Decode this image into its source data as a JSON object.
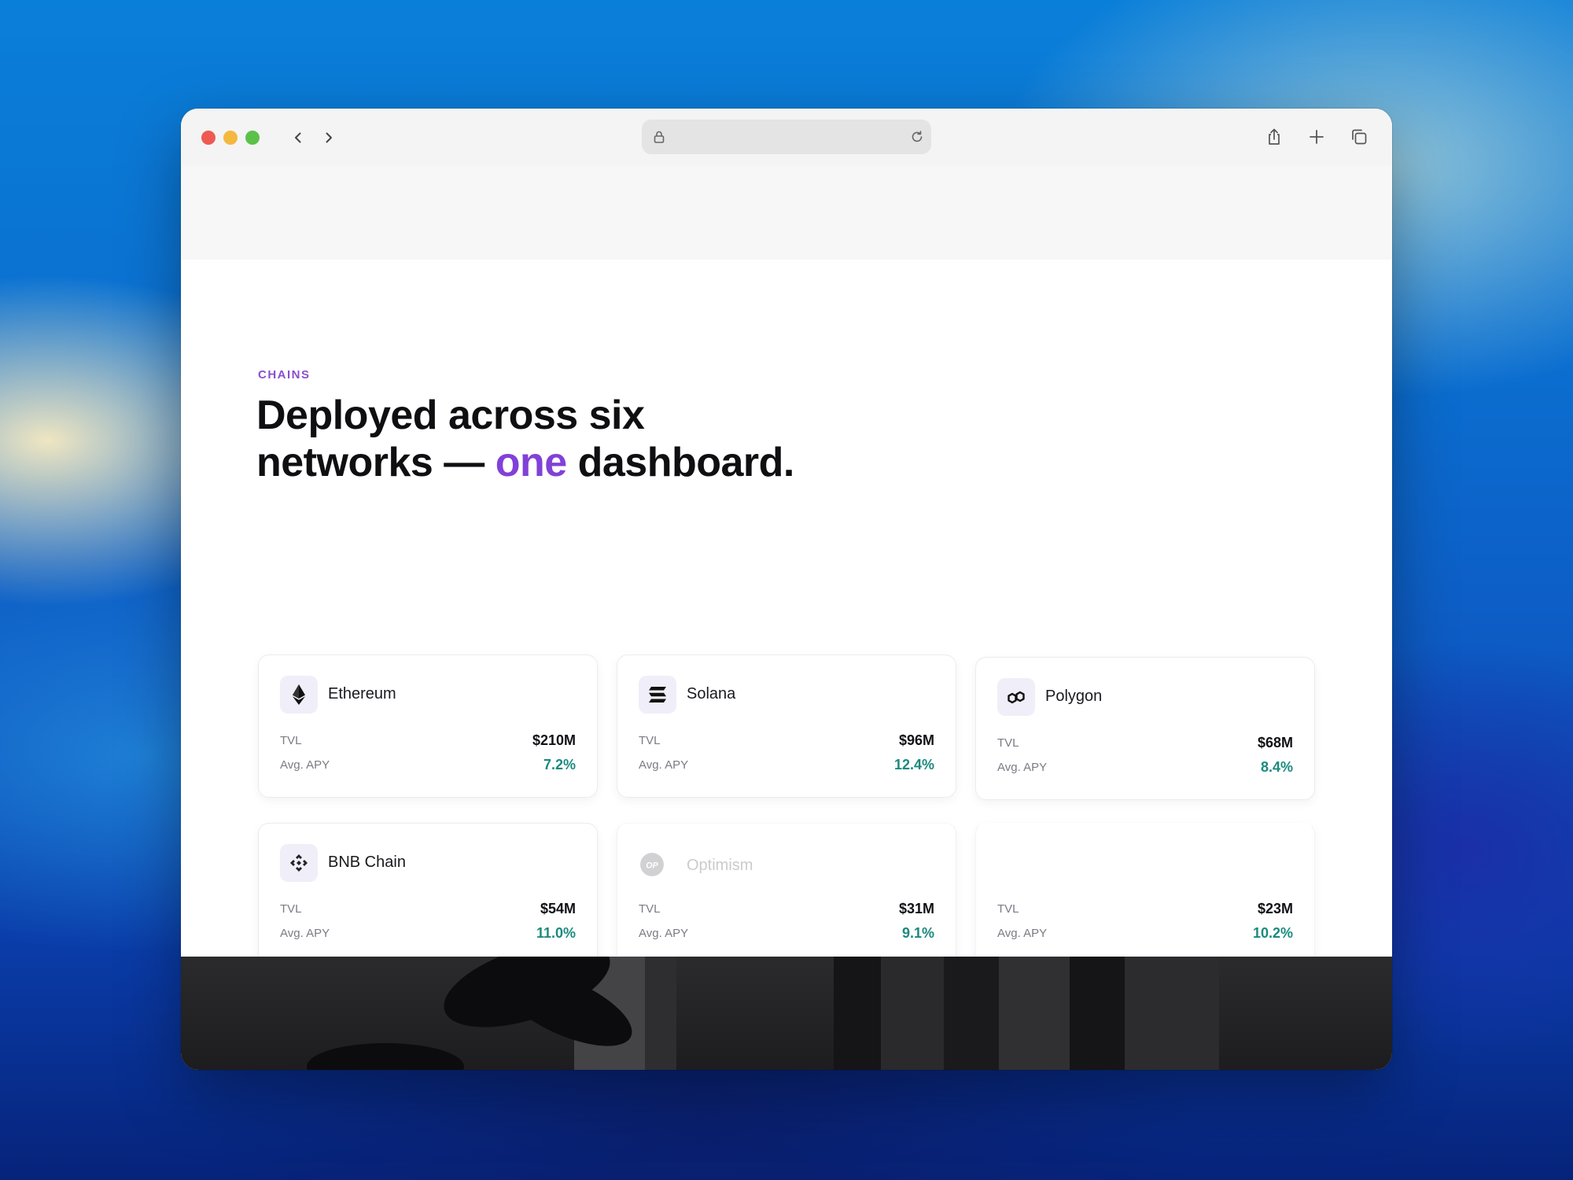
{
  "browser": {
    "icons": {
      "back": "chevron-left-icon",
      "forward": "chevron-right-icon",
      "lock": "lock-icon",
      "reload": "reload-icon",
      "share": "share-icon",
      "new_tab": "plus-icon",
      "tabs": "tabs-icon"
    }
  },
  "section": {
    "eyebrow": "CHAINS",
    "headline_line1": "Deployed across six",
    "headline_line2_pre": "networks — ",
    "headline_accent": "one",
    "headline_line2_post": " dashboard."
  },
  "colors": {
    "accent": "#8141d8",
    "eyebrow": "#8a4fd1",
    "apy": "#1a8a7e"
  },
  "chains": [
    {
      "name": "Ethereum",
      "icon": "ethereum-icon",
      "tvl_label": "TVL",
      "tvl": "$210M",
      "apy_label": "Avg. APY",
      "apy": "7.2%"
    },
    {
      "name": "Solana",
      "icon": "solana-icon",
      "tvl_label": "TVL",
      "tvl": "$96M",
      "apy_label": "Avg. APY",
      "apy": "12.4%"
    },
    {
      "name": "Polygon",
      "icon": "polygon-icon",
      "tvl_label": "TVL",
      "tvl": "$68M",
      "apy_label": "Avg. APY",
      "apy": "8.4%"
    },
    {
      "name": "BNB Chain",
      "icon": "bnb-icon",
      "tvl_label": "TVL",
      "tvl": "$54M",
      "apy_label": "Avg. APY",
      "apy": "11.0%"
    },
    {
      "name": "Optimism",
      "icon": "optimism-icon",
      "tvl_label": "TVL",
      "tvl": "$31M",
      "apy_label": "Avg. APY",
      "apy": "9.1%"
    },
    {
      "tvl_label": "TVL",
      "tvl": "$23M",
      "apy_label": "Avg. APY",
      "apy": "10.2%"
    }
  ]
}
